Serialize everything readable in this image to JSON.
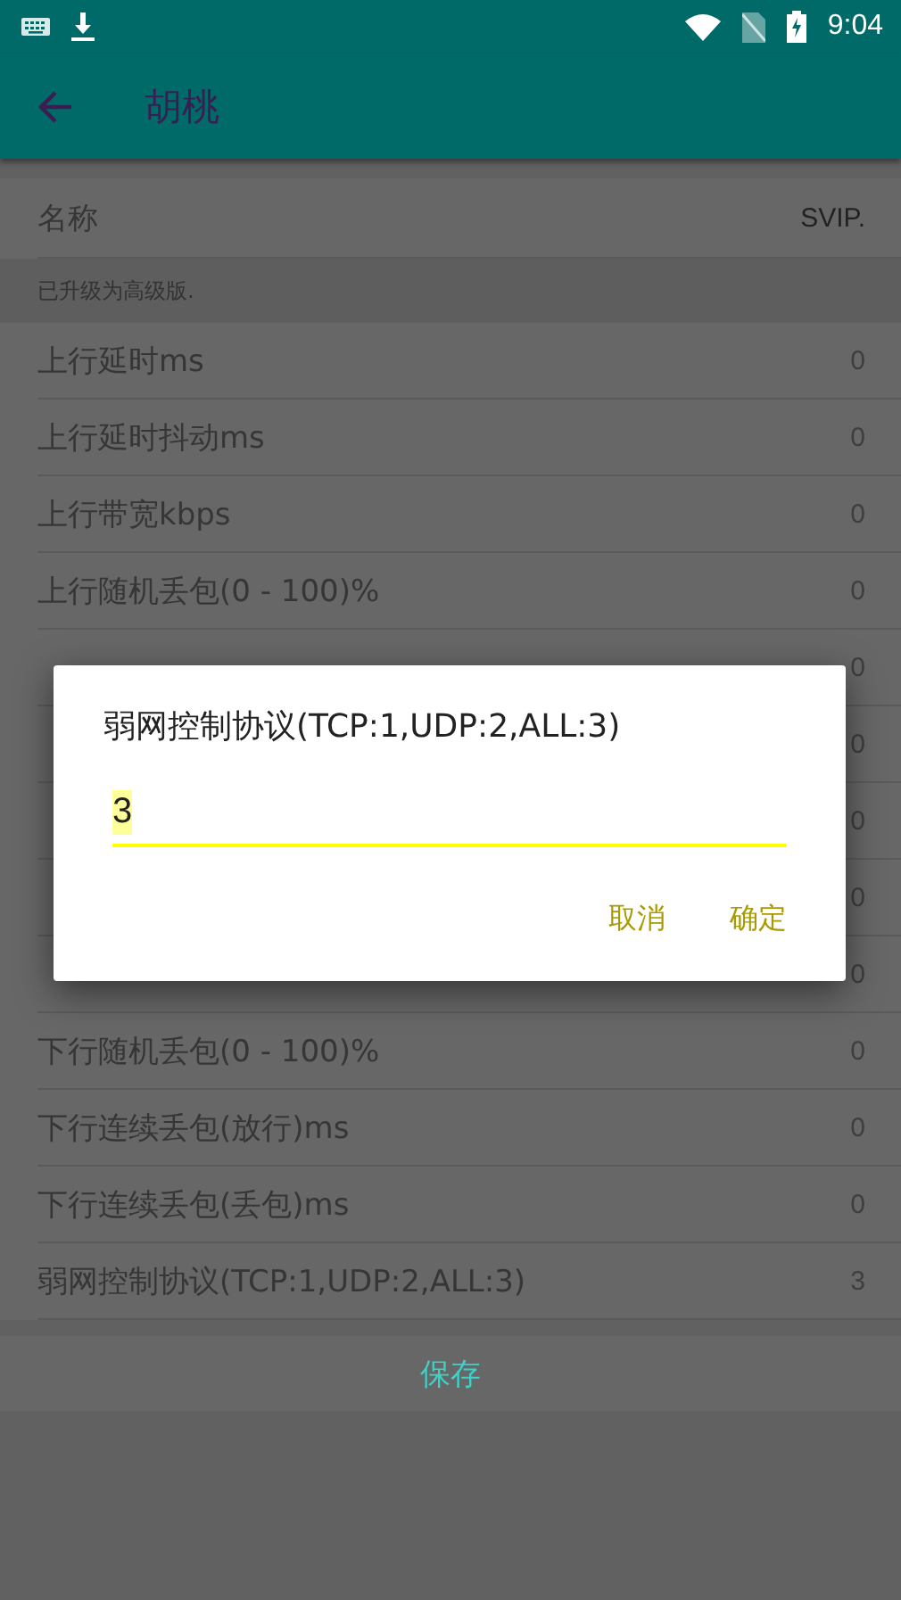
{
  "status_bar": {
    "time": "9:04"
  },
  "toolbar": {
    "title": "胡桃"
  },
  "name_row": {
    "label": "名称",
    "value": "SVIP."
  },
  "notice": "已升级为高级版.",
  "settings": [
    {
      "label": "上行延时ms",
      "value": "0"
    },
    {
      "label": "上行延时抖动ms",
      "value": "0"
    },
    {
      "label": "上行带宽kbps",
      "value": "0"
    },
    {
      "label": "上行随机丢包(0 - 100)%",
      "value": "0"
    },
    {
      "value": "0"
    },
    {
      "value": "0"
    },
    {
      "value": "0"
    },
    {
      "value": "0"
    },
    {
      "value": "0"
    },
    {
      "label": "下行随机丢包(0 - 100)%",
      "value": "0"
    },
    {
      "label": "下行连续丢包(放行)ms",
      "value": "0"
    },
    {
      "label": "下行连续丢包(丢包)ms",
      "value": "0"
    },
    {
      "label": "弱网控制协议(TCP:1,UDP:2,ALL:3)",
      "value": "3"
    }
  ],
  "save_button": "保存",
  "dialog": {
    "title": "弱网控制协议(TCP:1,UDP:2,ALL:3)",
    "input": {
      "value": "3",
      "text_selected": true
    },
    "buttons": [
      "取消",
      "确定"
    ]
  }
}
